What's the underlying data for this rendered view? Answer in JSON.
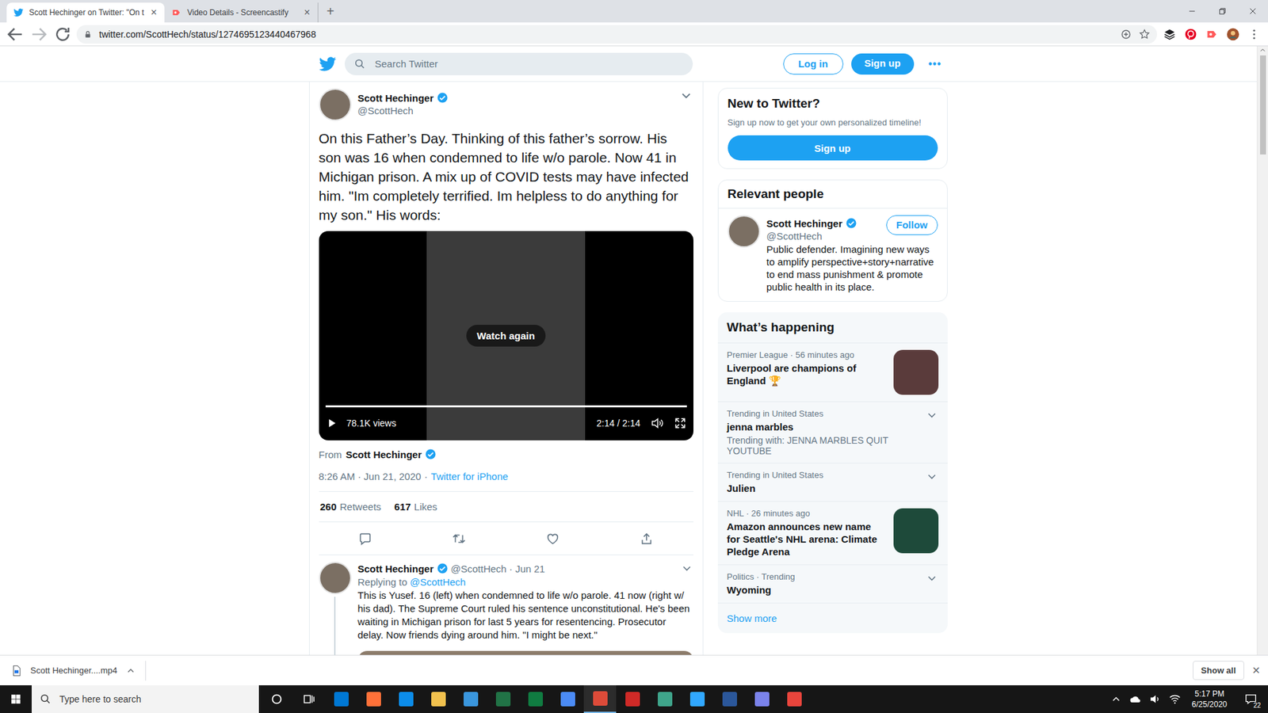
{
  "browser": {
    "tabs": [
      {
        "label": "Scott Hechinger on Twitter: \"On t",
        "selected": true,
        "close": "×"
      },
      {
        "label": "Video Details - Screencastify",
        "selected": false,
        "close": "×"
      }
    ],
    "new_tab": "+",
    "url": "twitter.com/ScottHech/status/1274695123440467968"
  },
  "header": {
    "search_placeholder": "Search Twitter",
    "login": "Log in",
    "signup": "Sign up",
    "more": "•••"
  },
  "tweet": {
    "author": "Scott Hechinger",
    "handle": "@ScottHech",
    "verified": true,
    "text": "On this Father’s Day. Thinking of this father’s sorrow. His son was 16 when condemned to life w/o parole. Now 41 in Michigan prison. A mix up of COVID tests may have infected him. \"Im completely terrified. Im helpless to do anything for my son.\" His words:",
    "video": {
      "overlay": "Watch again",
      "views": "78.1K views",
      "time": "2:14 / 2:14",
      "progress": 1
    },
    "from_label": "From",
    "from": "Scott Hechinger",
    "from_verified": true,
    "time": "8:26 AM · Jun 21, 2020",
    "sep": "·",
    "source": "Twitter for iPhone",
    "retweets": "260",
    "retweets_label": "Retweets",
    "likes": "617",
    "likes_label": "Likes"
  },
  "reply": {
    "author": "Scott Hechinger",
    "verified": true,
    "handle": "@ScottHech",
    "date": "· Jun 21",
    "replying_label": "Replying to",
    "replying_to": "@ScottHech",
    "text": "This is Yusef. 16 (left) when condemned to life w/o parole. 41 now (right w/ his dad). The Supreme Court ruled his sentence unconstitutional. He's been waiting in Michigan prison for last 5 years for resentencing. Prosecutor delay. Now friends dying around him. \"I might be next.\""
  },
  "sidebar": {
    "new_to_twitter": {
      "title": "New to Twitter?",
      "text": "Sign up now to get your own personalized timeline!",
      "button": "Sign up"
    },
    "relevant": {
      "title": "Relevant people",
      "name": "Scott Hechinger",
      "verified": true,
      "handle": "@ScottHech",
      "follow": "Follow",
      "bio": "Public defender. Imagining new ways to amplify perspective+story+narrative to end mass punishment & promote public health in its place."
    },
    "happening": {
      "title": "What’s happening",
      "items": [
        {
          "kind": "image",
          "meta": "Premier League · 56 minutes ago",
          "title": "Liverpool are champions of England 🏆"
        },
        {
          "kind": "trend",
          "meta": "Trending in United States",
          "title": "jenna marbles",
          "sub": "Trending with: JENNA MARBLES QUIT YOUTUBE"
        },
        {
          "kind": "trend",
          "meta": "Trending in United States",
          "title": "Julien"
        },
        {
          "kind": "image",
          "meta": "NHL · 26 minutes ago",
          "title": "Amazon announces new name for Seattle's NHL arena: Climate Pledge Arena"
        },
        {
          "kind": "trend",
          "meta": "Politics · Trending",
          "title": "Wyoming"
        }
      ],
      "show_more": "Show more"
    }
  },
  "downloads": {
    "file": "Scott Hechinger....mp4",
    "show_all": "Show all",
    "close": "×"
  },
  "taskbar": {
    "search": "Type here to search",
    "time": "5:17 PM",
    "date": "6/25/2020",
    "notifications": "22"
  }
}
